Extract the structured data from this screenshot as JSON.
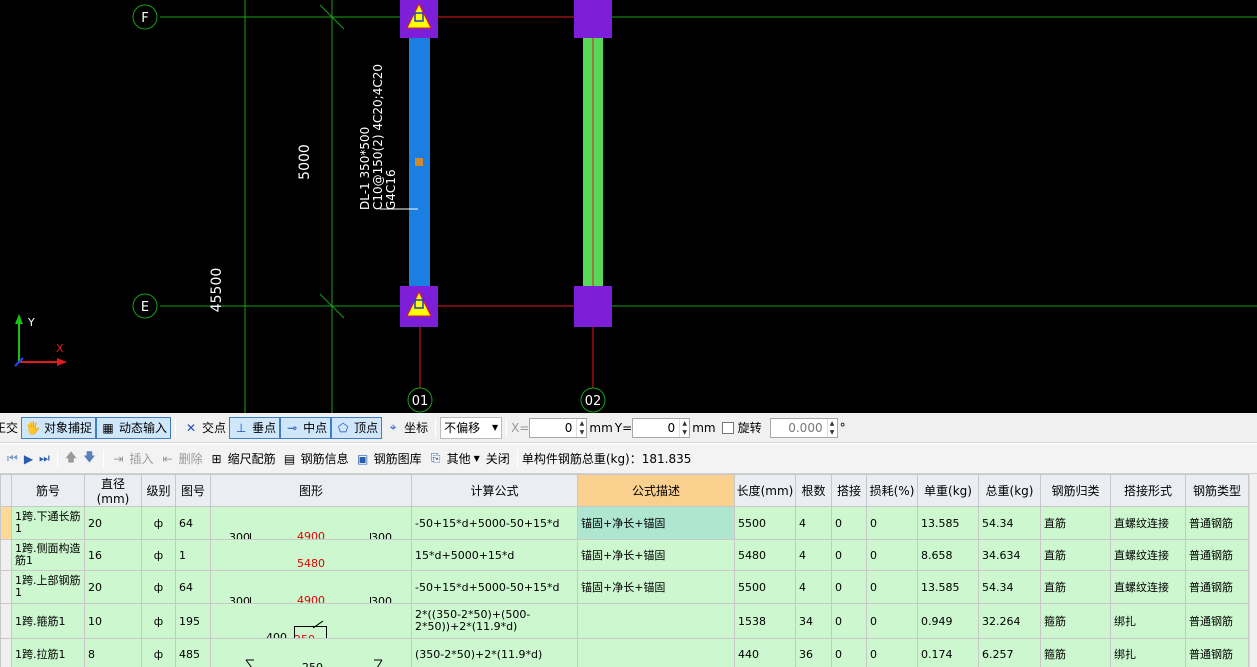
{
  "cad": {
    "axes": {
      "f": "F",
      "e": "E",
      "c01": "01",
      "c02": "02"
    },
    "dims": {
      "span": "5000",
      "total": "45500"
    },
    "beam_label": {
      "line1": "DL-1  350*500",
      "line2": "C10@150(2)  4C20;4C20",
      "line3": "G4C16"
    },
    "ucs": {
      "y": "Y",
      "x": "X"
    },
    "colors": {
      "beam_blue": "#1a7fe0",
      "beam_green": "#57d957",
      "column": "#7d1fd8",
      "grid_green": "#18a018",
      "grid_red": "#e01c1c"
    }
  },
  "snapbar": {
    "cut": "正交",
    "object_snap": "对象捕捉",
    "dynamic_input": "动态输入",
    "intersection": "交点",
    "perpendicular": "垂点",
    "midpoint": "中点",
    "vertex": "顶点",
    "coordinate": "坐标",
    "offset_mode": "不偏移",
    "x_label": "X=",
    "x_value": "0",
    "mm1": "mm",
    "y_label": "Y=",
    "y_value": "0",
    "mm2": "mm",
    "rotate": "旋转",
    "rotate_value": "0.000",
    "degree": "°"
  },
  "rebarbar": {
    "insert": "插入",
    "delete": "删除",
    "scale_rebar": "缩尺配筋",
    "rebar_info": "钢筋信息",
    "rebar_library": "钢筋图库",
    "other": "其他",
    "close": "关闭",
    "total_weight": "单构件钢筋总重(kg)：181.835"
  },
  "table": {
    "headers": [
      "筋号",
      "直径(mm)",
      "级别",
      "图号",
      "图形",
      "计算公式",
      "公式描述",
      "长度(mm)",
      "根数",
      "搭接",
      "损耗(%)",
      "单重(kg)",
      "总重(kg)",
      "钢筋归类",
      "搭接形式",
      "钢筋类型"
    ],
    "rows": [
      {
        "name": "1跨.下通长筋1",
        "dia": "20",
        "grade": "ф",
        "fig": "64",
        "shape_left": "300",
        "shape_mid": "4900",
        "shape_right": "300",
        "formula": "-50+15*d+5000-50+15*d",
        "desc": "锚固+净长+锚固",
        "len": "5500",
        "count": "4",
        "lap": "0",
        "loss": "0",
        "unit_w": "13.585",
        "total_w": "54.34",
        "cls": "直筋",
        "lap_type": "直螺纹连接",
        "type": "普通钢筋"
      },
      {
        "name": "1跨.侧面构造筋1",
        "dia": "16",
        "grade": "ф",
        "fig": "1",
        "shape_left": "",
        "shape_mid": "5480",
        "shape_right": "",
        "formula": "15*d+5000+15*d",
        "desc": "锚固+净长+锚固",
        "len": "5480",
        "count": "4",
        "lap": "0",
        "loss": "0",
        "unit_w": "8.658",
        "total_w": "34.634",
        "cls": "直筋",
        "lap_type": "直螺纹连接",
        "type": "普通钢筋"
      },
      {
        "name": "1跨.上部钢筋1",
        "dia": "20",
        "grade": "ф",
        "fig": "64",
        "shape_left": "300",
        "shape_mid": "4900",
        "shape_right": "300",
        "formula": "-50+15*d+5000-50+15*d",
        "desc": "锚固+净长+锚固",
        "len": "5500",
        "count": "4",
        "lap": "0",
        "loss": "0",
        "unit_w": "13.585",
        "total_w": "54.34",
        "cls": "直筋",
        "lap_type": "直螺纹连接",
        "type": "普通钢筋"
      },
      {
        "name": "1跨.箍筋1",
        "dia": "10",
        "grade": "ф",
        "fig": "195",
        "shape_left": "400",
        "shape_mid": "250",
        "shape_right": "",
        "formula": "2*((350-2*50)+(500-2*50))+2*(11.9*d)",
        "desc": "",
        "len": "1538",
        "count": "34",
        "lap": "0",
        "loss": "0",
        "unit_w": "0.949",
        "total_w": "32.264",
        "cls": "箍筋",
        "lap_type": "绑扎",
        "type": "普通钢筋"
      },
      {
        "name": "1跨.拉筋1",
        "dia": "8",
        "grade": "ф",
        "fig": "485",
        "shape_left": "",
        "shape_mid": "250",
        "shape_right": "",
        "formula": "(350-2*50)+2*(11.9*d)",
        "desc": "",
        "len": "440",
        "count": "36",
        "lap": "0",
        "loss": "0",
        "unit_w": "0.174",
        "total_w": "6.257",
        "cls": "箍筋",
        "lap_type": "绑扎",
        "type": "普通钢筋"
      }
    ]
  }
}
